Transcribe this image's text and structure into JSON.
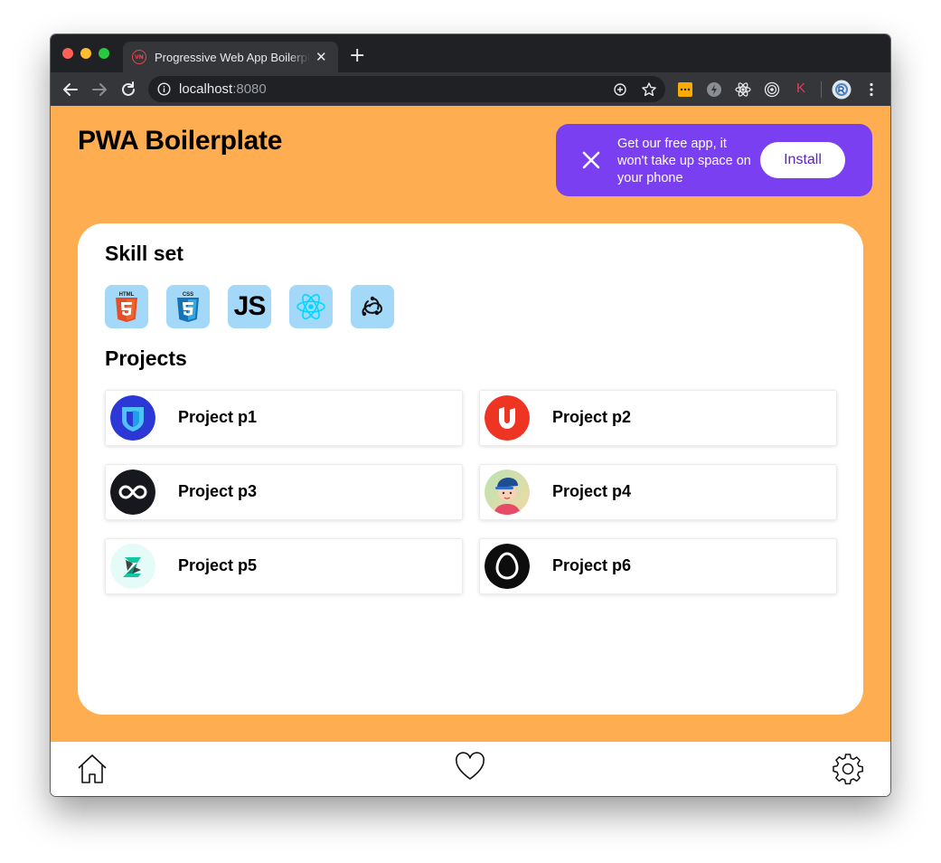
{
  "browser": {
    "tab_title": "Progressive Web App Boilerplate",
    "tab_favicon_text": "VN",
    "tab_close": "✕",
    "new_tab": "+",
    "url_host": "localhost",
    "url_port": ":8080",
    "extension_k_label": "K"
  },
  "app": {
    "title": "PWA Boilerplate",
    "banner": {
      "text": "Get our free app, it won't take up space on your phone",
      "install_label": "Install",
      "color": "#7b3ff2"
    },
    "background_color": "#ffad51",
    "skills_heading": "Skill set",
    "skills": [
      {
        "name": "html5",
        "label": "HTML"
      },
      {
        "name": "css3",
        "label": "CSS"
      },
      {
        "name": "javascript",
        "label": "JS"
      },
      {
        "name": "react",
        "label": ""
      },
      {
        "name": "redux",
        "label": ""
      }
    ],
    "projects_heading": "Projects",
    "projects": [
      {
        "name": "Project p1",
        "icon": "shield-logo"
      },
      {
        "name": "Project p2",
        "icon": "u-logo"
      },
      {
        "name": "Project p3",
        "icon": "infinity-logo"
      },
      {
        "name": "Project p4",
        "icon": "boy-avatar"
      },
      {
        "name": "Project p5",
        "icon": "z-logo"
      },
      {
        "name": "Project p6",
        "icon": "egg-logo"
      }
    ]
  },
  "bottom_nav": [
    {
      "name": "home",
      "icon": "home-icon"
    },
    {
      "name": "favorites",
      "icon": "heart-icon"
    },
    {
      "name": "settings",
      "icon": "gear-icon"
    }
  ]
}
